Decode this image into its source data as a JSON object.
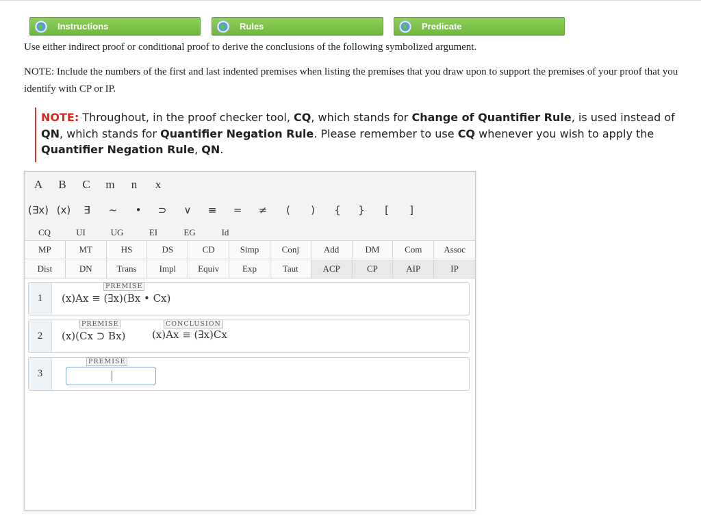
{
  "tabs": [
    {
      "label": "Instructions",
      "icon": "globe-icon"
    },
    {
      "label": "Rules",
      "icon": "globe-icon"
    },
    {
      "label": "Predicate",
      "icon": "globe-icon"
    }
  ],
  "instructions": {
    "line1": "Use either indirect proof or conditional proof to derive the conclusions of the following symbolized argument.",
    "note_line": "NOTE: Include the numbers of the first and last indented premises when listing the premises that you draw upon to support the premises of your proof that you identify with CP or IP."
  },
  "quantifier_note": {
    "prefix": "NOTE:",
    "t1": " Throughout, in the proof checker tool, ",
    "b1": "CQ",
    "t2": ", which stands for ",
    "b2": "Change of Quantifier Rule",
    "t3": ", is used instead of ",
    "b3": "QN",
    "t4": ", which stands for ",
    "b4": "Quantifier Negation Rule",
    "t5": ". Please remember to use ",
    "b5": "CQ",
    "t6": " whenever you wish to apply the ",
    "b6": "Quantifier Negation Rule",
    "t7": ", ",
    "b7": "QN",
    "t8": "."
  },
  "keyboard": {
    "letters": [
      "A",
      "B",
      "C",
      "m",
      "n",
      "x"
    ],
    "symbols": [
      "(∃x)",
      "(x)",
      "∃",
      "~",
      "•",
      "⊃",
      "∨",
      "≡",
      "=",
      "≠",
      "(",
      ")",
      "{",
      "}",
      "[",
      "]"
    ],
    "quantifier_rules": [
      "CQ",
      "UI",
      "UG",
      "EI",
      "EG",
      "Id"
    ],
    "rules_row1": [
      "MP",
      "MT",
      "HS",
      "DS",
      "CD",
      "Simp",
      "Conj",
      "Add",
      "DM",
      "Com",
      "Assoc"
    ],
    "rules_row2": [
      "Dist",
      "DN",
      "Trans",
      "Impl",
      "Equiv",
      "Exp",
      "Taut",
      "ACP",
      "CP",
      "AIP",
      "IP"
    ]
  },
  "proof": {
    "lines": [
      {
        "num": "1",
        "tag": "PREMISE",
        "formula": "(x)Ax ≡ (∃x)(Bx • Cx)"
      },
      {
        "num": "2",
        "tag": "PREMISE",
        "formula": "(x)(Cx ⊃ Bx)",
        "conclusion_tag": "CONCLUSION",
        "conclusion": "(x)Ax ≡ (∃x)Cx"
      },
      {
        "num": "3",
        "tag": "PREMISE",
        "formula": ""
      }
    ]
  },
  "colors": {
    "tab_green": "#7cc14a",
    "note_red": "#e0251b",
    "input_border": "#7fa6d6"
  }
}
